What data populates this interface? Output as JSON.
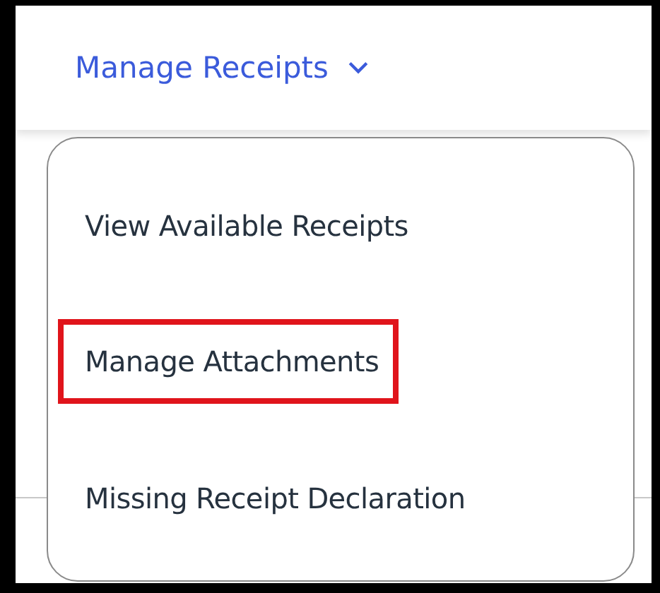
{
  "header": {
    "menu_button": {
      "label": "Manage Receipts",
      "expanded": true
    }
  },
  "dropdown": {
    "items": [
      {
        "label": "View Available Receipts",
        "highlighted": false
      },
      {
        "label": "Manage Attachments",
        "highlighted": true
      },
      {
        "label": "Missing Receipt Declaration",
        "highlighted": false
      }
    ]
  }
}
